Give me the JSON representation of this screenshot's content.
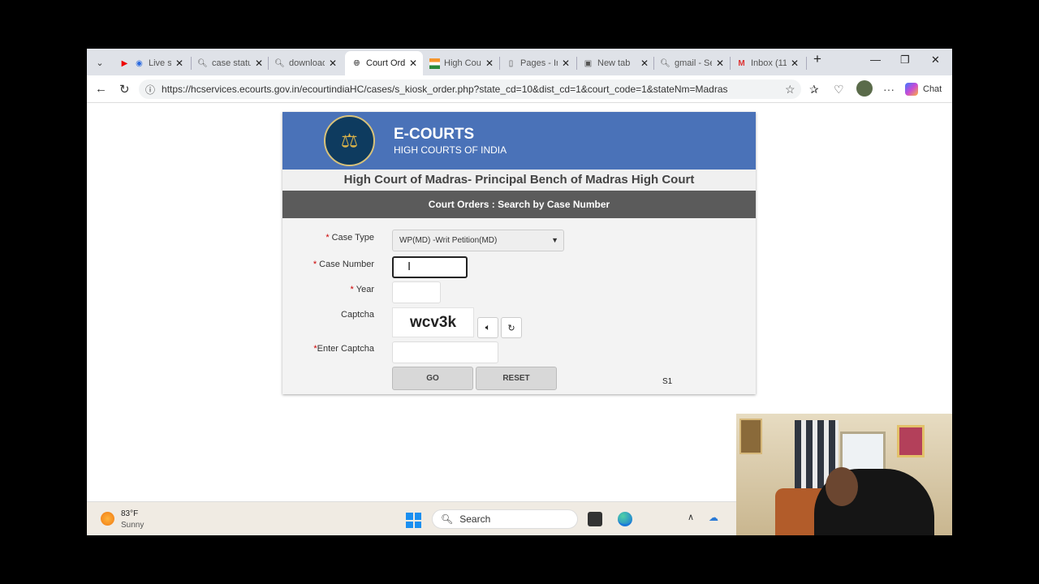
{
  "browser": {
    "tabs": [
      {
        "title": "Live st",
        "icon": "youtube-icon",
        "active": false
      },
      {
        "title": "case status",
        "icon": "search-icon",
        "active": false
      },
      {
        "title": "download",
        "icon": "search-icon",
        "active": false
      },
      {
        "title": "Court Orde",
        "icon": "globe-icon",
        "active": true
      },
      {
        "title": "High Cour",
        "icon": "india-flag-icon",
        "active": false
      },
      {
        "title": "Pages - Ind",
        "icon": "page-icon",
        "active": false
      },
      {
        "title": "New tab",
        "icon": "newtab-icon",
        "active": false
      },
      {
        "title": "gmail - Se",
        "icon": "search-icon",
        "active": false
      },
      {
        "title": "Inbox (11",
        "icon": "gmail-icon",
        "active": false
      }
    ],
    "url": "https://hcservices.ecourts.gov.in/ecourtindiaHC/cases/s_kiosk_order.php?state_cd=10&dist_cd=1&court_code=1&stateNm=Madras",
    "copilot_label": "Chat"
  },
  "page": {
    "brand_title": "E-COURTS",
    "brand_subtitle": "HIGH COURTS OF INDIA",
    "court_name": "High Court of Madras- Principal Bench of Madras High Court",
    "form_title": "Court Orders : Search by Case Number",
    "labels": {
      "case_type": "Case Type",
      "case_number": "Case Number",
      "year": "Year",
      "captcha": "Captcha",
      "enter_captcha": "Enter Captcha"
    },
    "required_mark": "*",
    "case_type_value": "WP(MD) -Writ Petition(MD)",
    "case_number_value": "",
    "year_value": "",
    "captcha_text": "wcv3k",
    "enter_captcha_value": "",
    "go_label": "GO",
    "reset_label": "RESET",
    "server_code": "S1"
  },
  "taskbar": {
    "temperature": "83°F",
    "condition": "Sunny",
    "search_placeholder": "Search"
  },
  "colors": {
    "banner": "#4a72b8",
    "form_header": "#5b5b5b",
    "required": "#cc0000"
  }
}
